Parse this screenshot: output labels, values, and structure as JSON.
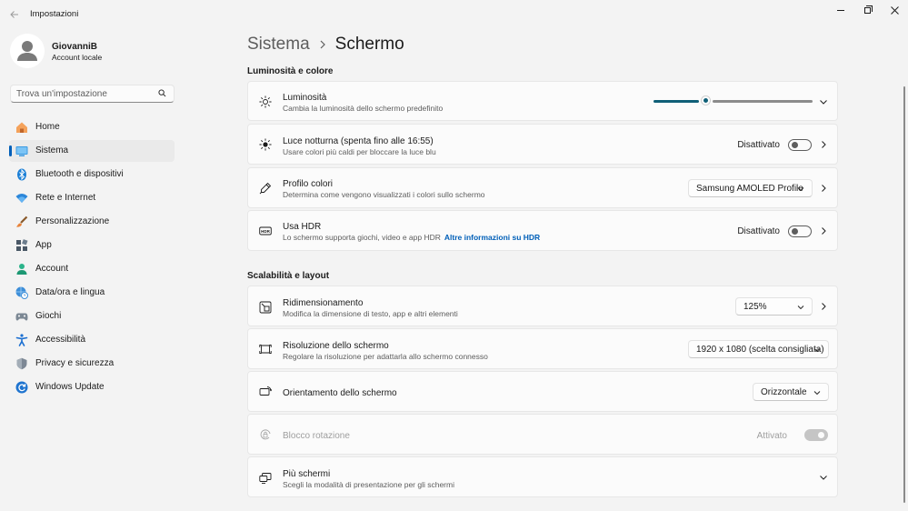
{
  "window": {
    "title": "Impostazioni",
    "back_icon": "arrow-left-icon"
  },
  "profile": {
    "name": "GiovanniB",
    "account_type": "Account locale"
  },
  "search": {
    "placeholder": "Trova un'impostazione"
  },
  "nav": {
    "items": [
      {
        "label": "Home",
        "icon": "home-icon"
      },
      {
        "label": "Sistema",
        "icon": "system-icon",
        "active": true
      },
      {
        "label": "Bluetooth e dispositivi",
        "icon": "bluetooth-icon"
      },
      {
        "label": "Rete e Internet",
        "icon": "wifi-icon"
      },
      {
        "label": "Personalizzazione",
        "icon": "brush-icon"
      },
      {
        "label": "App",
        "icon": "apps-icon"
      },
      {
        "label": "Account",
        "icon": "account-icon"
      },
      {
        "label": "Data/ora e lingua",
        "icon": "globe-clock-icon"
      },
      {
        "label": "Giochi",
        "icon": "gamepad-icon"
      },
      {
        "label": "Accessibilità",
        "icon": "accessibility-icon"
      },
      {
        "label": "Privacy e sicurezza",
        "icon": "shield-icon"
      },
      {
        "label": "Windows Update",
        "icon": "update-icon"
      }
    ]
  },
  "header": {
    "parent": "Sistema",
    "current": "Schermo"
  },
  "sections": {
    "brightness_color": "Luminosità e colore",
    "scale_layout": "Scalabilità e layout"
  },
  "settings": {
    "brightness": {
      "title": "Luminosità",
      "desc": "Cambia la luminosità dello schermo predefinito",
      "value": 0.32
    },
    "night_light": {
      "title": "Luce notturna (spenta fino alle 16:55)",
      "desc": "Usare colori più caldi per bloccare la luce blu",
      "state": "Disattivato"
    },
    "color_profile": {
      "title": "Profilo colori",
      "desc": "Determina come vengono visualizzati i colori sullo schermo",
      "selected": "Samsung AMOLED Profile"
    },
    "hdr": {
      "title": "Usa HDR",
      "desc": "Lo schermo supporta giochi, video e app HDR",
      "link": "Altre informazioni su HDR",
      "state": "Disattivato"
    },
    "scale": {
      "title": "Ridimensionamento",
      "desc": "Modifica la dimensione di testo, app e altri elementi",
      "selected": "125%"
    },
    "resolution": {
      "title": "Risoluzione dello schermo",
      "desc": "Regolare la risoluzione per adattarla allo schermo connesso",
      "selected": "1920 x 1080 (scelta consigliata)"
    },
    "orientation": {
      "title": "Orientamento dello schermo",
      "selected": "Orizzontale"
    },
    "rotation_lock": {
      "title": "Blocco rotazione",
      "state": "Attivato",
      "disabled": true
    },
    "multiple_displays": {
      "title": "Più schermi",
      "desc": "Scegli la modalità di presentazione per gli schermi"
    }
  }
}
